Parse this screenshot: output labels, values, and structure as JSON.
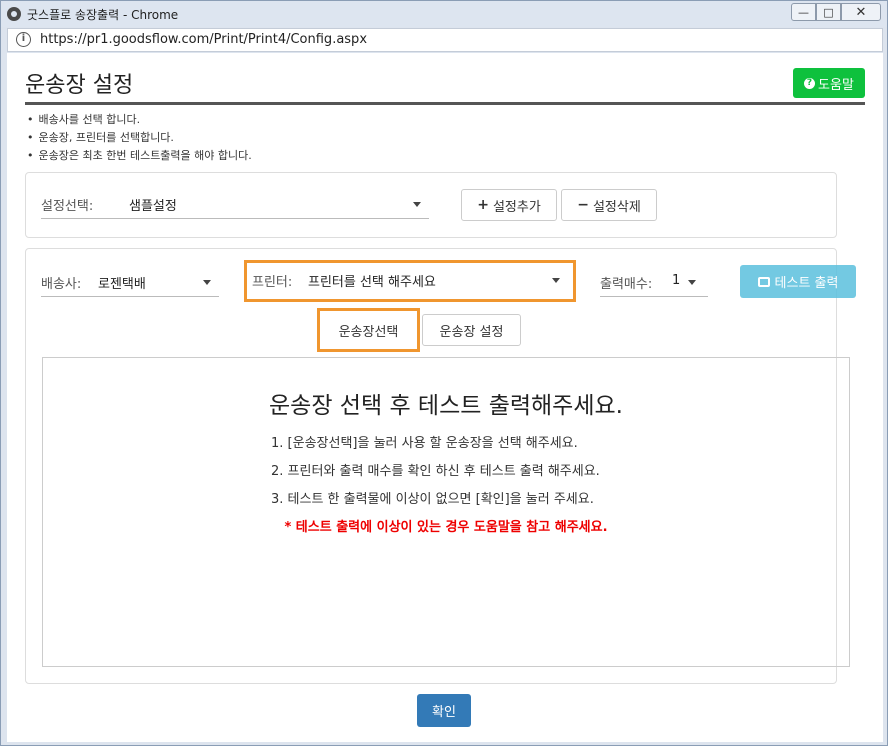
{
  "window": {
    "title": "굿스플로 송장출력 - Chrome",
    "url": "https://pr1.goodsflow.com/Print/Print4/Config.aspx",
    "min_glyph": "—",
    "max_glyph": "□",
    "close_glyph": "✕"
  },
  "page": {
    "title": "운송장 설정",
    "help_label": "도움말",
    "help_glyph": "?",
    "notes": [
      "배송사를 선택 합니다.",
      "운송장, 프린터를 선택합니다.",
      "운송장은 최초 한번 테스트출력을 해야 합니다."
    ]
  },
  "settings": {
    "select_label": "설정선택:",
    "select_value": "샘플설정",
    "add_label": "설정추가",
    "delete_label": "설정삭제",
    "add_glyph": "+",
    "delete_glyph": "−"
  },
  "print": {
    "carrier_label": "배송사:",
    "carrier_value": "로젠택배",
    "printer_label": "프린터:",
    "printer_value": "프린터를 선택 해주세요",
    "copies_label": "출력매수:",
    "copies_value": "1",
    "test_print_label": "테스트 출력"
  },
  "tabs": {
    "waybill_select": "운송장선택",
    "waybill_settings": "운송장 설정"
  },
  "preview": {
    "heading": "운송장 선택 후 테스트 출력해주세요.",
    "steps": [
      "1. [운송장선택]을 눌러 사용 할 운송장을 선택 해주세요.",
      "2. 프린터와 출력 매수를 확인 하신 후 테스트 출력 해주세요.",
      "3. 테스트 한 출력물에 이상이 없으면 [확인]을 눌러 주세요."
    ],
    "warning": "* 테스트 출력에 이상이 있는 경우 도움말을 참고 해주세요."
  },
  "footer": {
    "confirm_label": "확인"
  },
  "colors": {
    "help_green": "#0ec13d",
    "info_blue": "#5bc0de",
    "primary_blue": "#337ab7",
    "highlight_orange": "#f0962f",
    "warning_red": "#ee0000"
  }
}
